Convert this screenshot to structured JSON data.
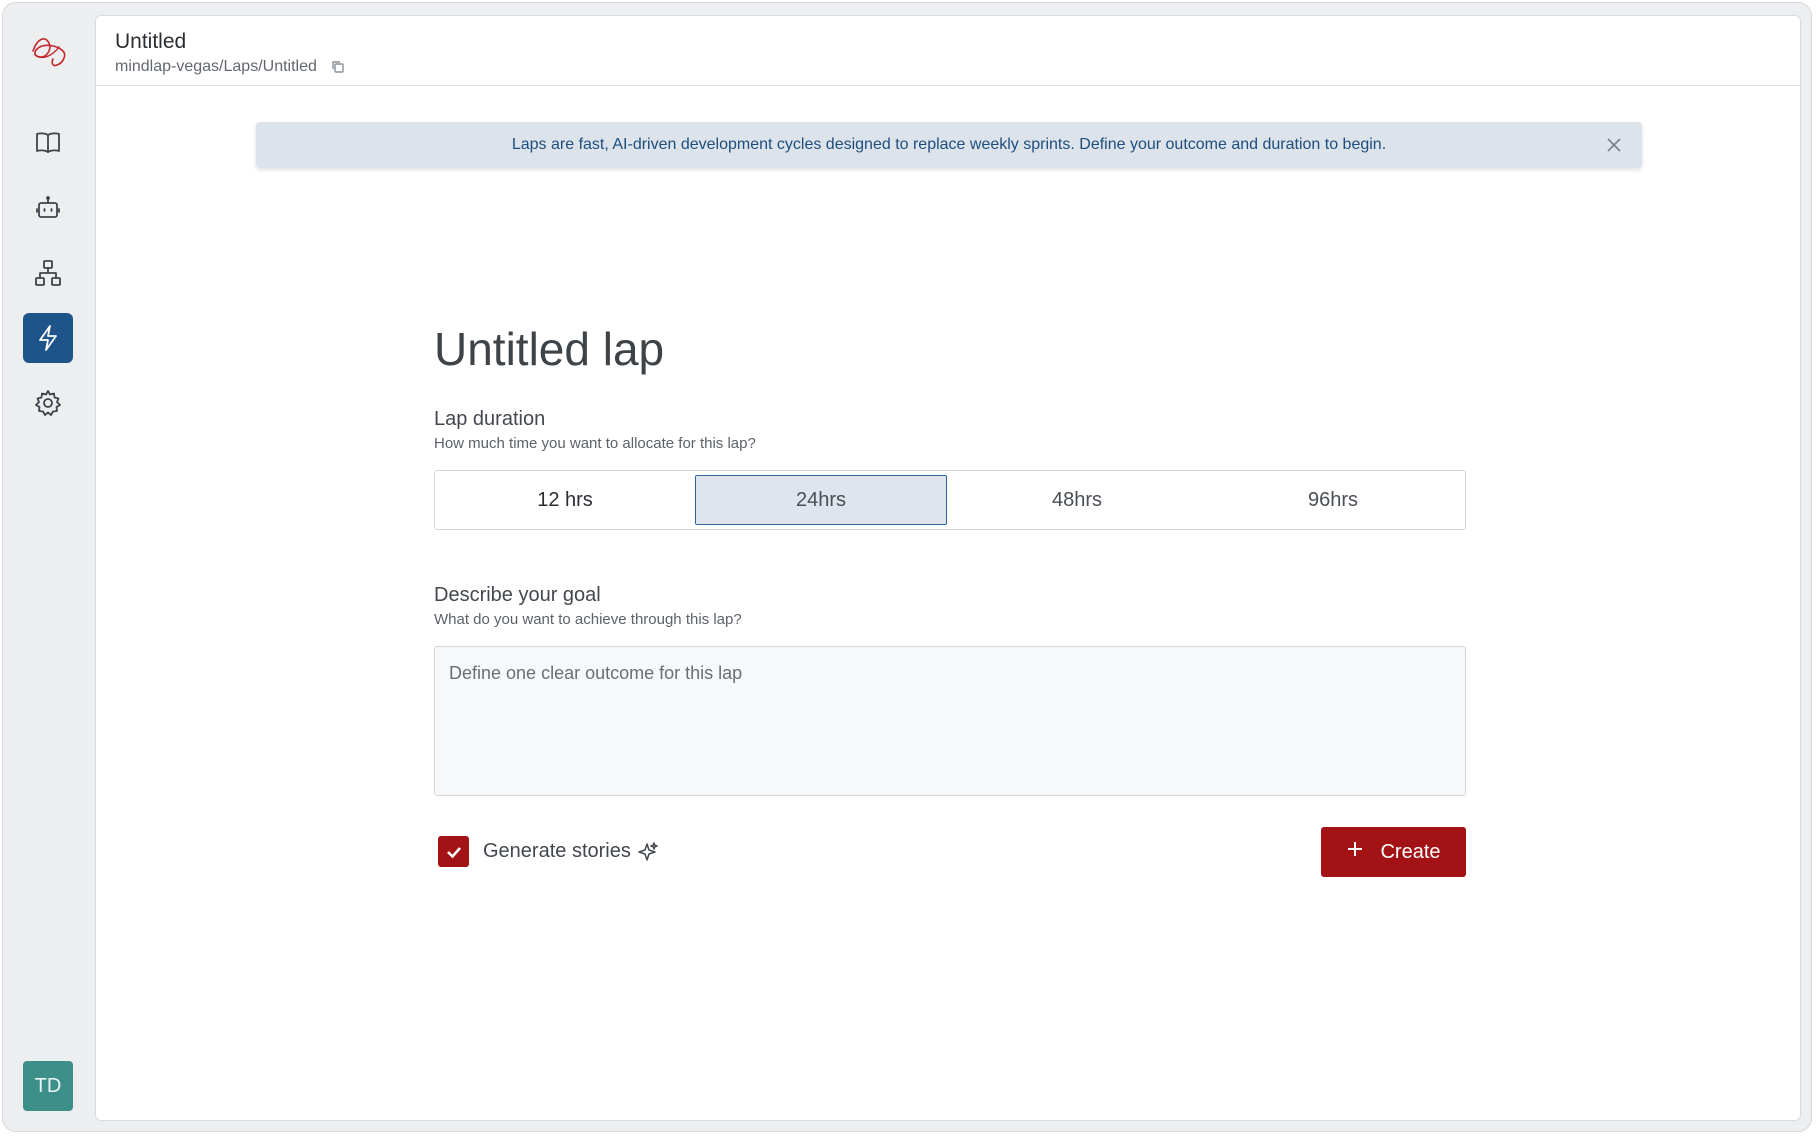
{
  "header": {
    "title": "Untitled",
    "path": "mindlap-vegas/Laps/Untitled"
  },
  "banner": {
    "text": "Laps are fast, AI-driven development cycles designed to replace weekly sprints. Define your outcome and duration to begin."
  },
  "sidebar": {
    "items": [
      {
        "icon": "book-icon"
      },
      {
        "icon": "robot-icon"
      },
      {
        "icon": "hierarchy-icon"
      },
      {
        "icon": "lightning-icon",
        "active": true
      },
      {
        "icon": "gear-icon"
      }
    ],
    "avatar_initials": "TD",
    "active_color": "#1e5489"
  },
  "form": {
    "title": "Untitled lap",
    "duration_label": "Lap duration",
    "duration_hint": "How much time you want to allocate for this lap?",
    "duration_options": [
      "12 hrs",
      "24hrs",
      "48hrs",
      "96hrs"
    ],
    "duration_selected": "24hrs",
    "goal_label": "Describe your goal",
    "goal_hint": "What do you want to achieve through this lap?",
    "goal_placeholder": "Define one clear outcome for this lap",
    "goal_value": "",
    "generate_stories_label": "Generate stories",
    "generate_stories_checked": true,
    "create_label": "Create",
    "accent_color": "#a31214"
  }
}
